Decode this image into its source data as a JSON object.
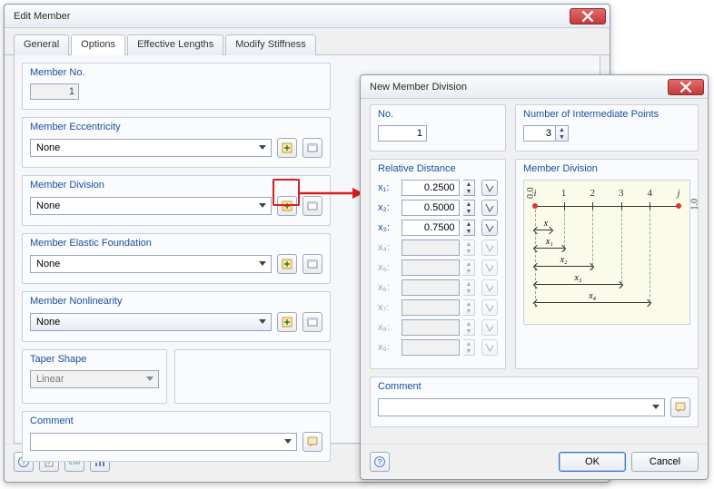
{
  "editMember": {
    "title": "Edit Member",
    "tabs": [
      "General",
      "Options",
      "Effective Lengths",
      "Modify Stiffness"
    ],
    "activeTab": 1,
    "groups": {
      "memberNo": {
        "legend": "Member No.",
        "value": "1"
      },
      "eccentricity": {
        "legend": "Member Eccentricity",
        "value": "None"
      },
      "division": {
        "legend": "Member Division",
        "value": "None"
      },
      "elastic": {
        "legend": "Member Elastic Foundation",
        "value": "None"
      },
      "nonlinearity": {
        "legend": "Member Nonlinearity",
        "value": "None"
      },
      "taper": {
        "legend": "Taper Shape",
        "value": "Linear"
      },
      "comment": {
        "legend": "Comment",
        "value": ""
      }
    },
    "buttons": {
      "ok": "OK",
      "cancel": "Cancel"
    }
  },
  "newDivision": {
    "title": "New Member Division",
    "no": {
      "legend": "No.",
      "value": "1"
    },
    "count": {
      "legend": "Number of Intermediate Points",
      "value": "3"
    },
    "relDist": {
      "legend": "Relative Distance",
      "rows": [
        {
          "label": "x₁:",
          "value": "0.2500",
          "enabled": true
        },
        {
          "label": "x₂:",
          "value": "0.5000",
          "enabled": true
        },
        {
          "label": "x₃:",
          "value": "0.7500",
          "enabled": true
        },
        {
          "label": "x₄:",
          "value": "",
          "enabled": false
        },
        {
          "label": "x₅:",
          "value": "",
          "enabled": false
        },
        {
          "label": "x₆:",
          "value": "",
          "enabled": false
        },
        {
          "label": "x₇:",
          "value": "",
          "enabled": false
        },
        {
          "label": "x₈:",
          "value": "",
          "enabled": false
        },
        {
          "label": "x₉:",
          "value": "",
          "enabled": false
        }
      ]
    },
    "preview": {
      "legend": "Member Division",
      "nodes": [
        "i",
        "1",
        "2",
        "3",
        "4",
        "j"
      ],
      "end0": "0.0",
      "end1": "1.0",
      "dims": [
        "x",
        "x₁",
        "x₂",
        "x₃",
        "x₄"
      ]
    },
    "comment": {
      "legend": "Comment",
      "value": ""
    },
    "buttons": {
      "ok": "OK",
      "cancel": "Cancel"
    }
  }
}
